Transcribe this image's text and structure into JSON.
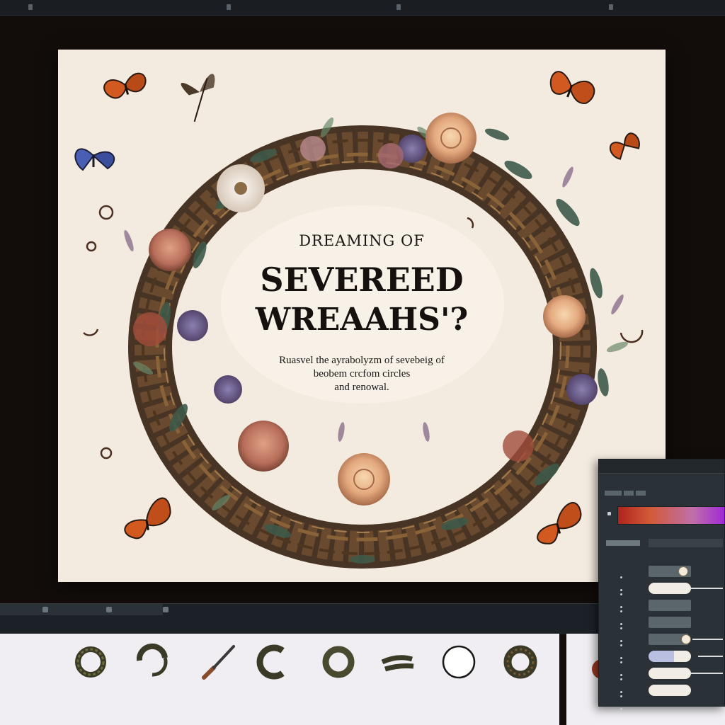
{
  "canvas": {
    "title_line1": "DREAMING OF",
    "title_line2": "SEVEREED",
    "title_line3": "WREAAHS'?",
    "subtitle_line1": "Ruasvel the ayrabolyzm of sevebeig of",
    "subtitle_line2": "beobem crcfom circles",
    "subtitle_line3": "and renowal."
  },
  "colors": {
    "canvas_bg": "#f3ebe0",
    "app_bg": "#120d0b",
    "panel_bg": "#2b3237",
    "wreath_brown": "#5b4028",
    "leaf_green": "#3e5a4a",
    "butterfly_orange": "#d2591f"
  },
  "icons": [
    "butterfly-icon",
    "wreath-icon",
    "knife-icon",
    "ring-icon",
    "flower-icon"
  ],
  "gradient": {
    "stops": [
      "#b0231d",
      "#d25a38",
      "#c06fa8",
      "#a02ad6"
    ]
  }
}
